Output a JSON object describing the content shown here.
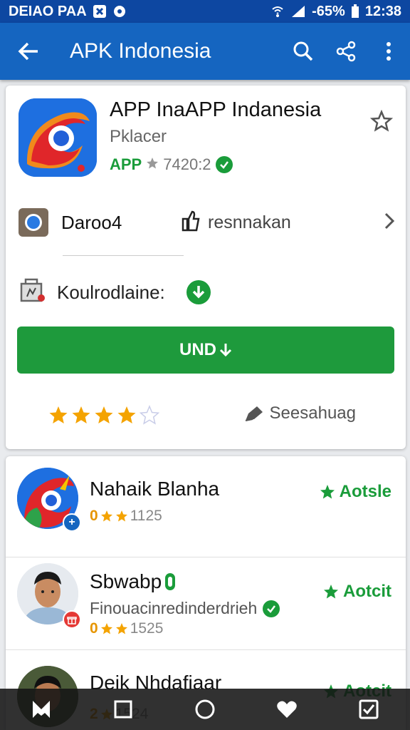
{
  "status_bar": {
    "carrier": "DEIAO PAA",
    "battery_pct": "-65%",
    "time": "12:38"
  },
  "app_bar": {
    "title": "APK Indonesia",
    "icons": [
      "back-arrow-icon",
      "search-icon",
      "share-icon",
      "more-vert-icon"
    ]
  },
  "app": {
    "name": "APP InaAPP Indanesia",
    "developer": "Pklacer",
    "meta_prefix": "APP",
    "meta_count": "7420:2",
    "dev_row_label": "Daroo4",
    "recommend_label": "resnnakan",
    "download_label": "Koulrodlaine:",
    "install_label": "UND",
    "rating": 4,
    "rating_max": 5,
    "share_label": "Seesahuag"
  },
  "list": [
    {
      "name": "Nahaik Blanha",
      "subtitle": "",
      "rating_prefix": "0",
      "rating_count": "1125",
      "action": "Aotsle"
    },
    {
      "name": "Sbwabp",
      "subtitle": "Finouacinredinderdrieh",
      "rating_prefix": "0",
      "rating_count": "1525",
      "action": "Aotcit"
    },
    {
      "name": "Deik Nhdafiaar",
      "subtitle": "",
      "rating_prefix": "2",
      "rating_count": "1524",
      "action": "Aotcit"
    }
  ],
  "colors": {
    "status_bar": "#0d47a1",
    "app_bar": "#1565c0",
    "primary_green": "#1e9a3c",
    "star_gold": "#f4a300"
  }
}
